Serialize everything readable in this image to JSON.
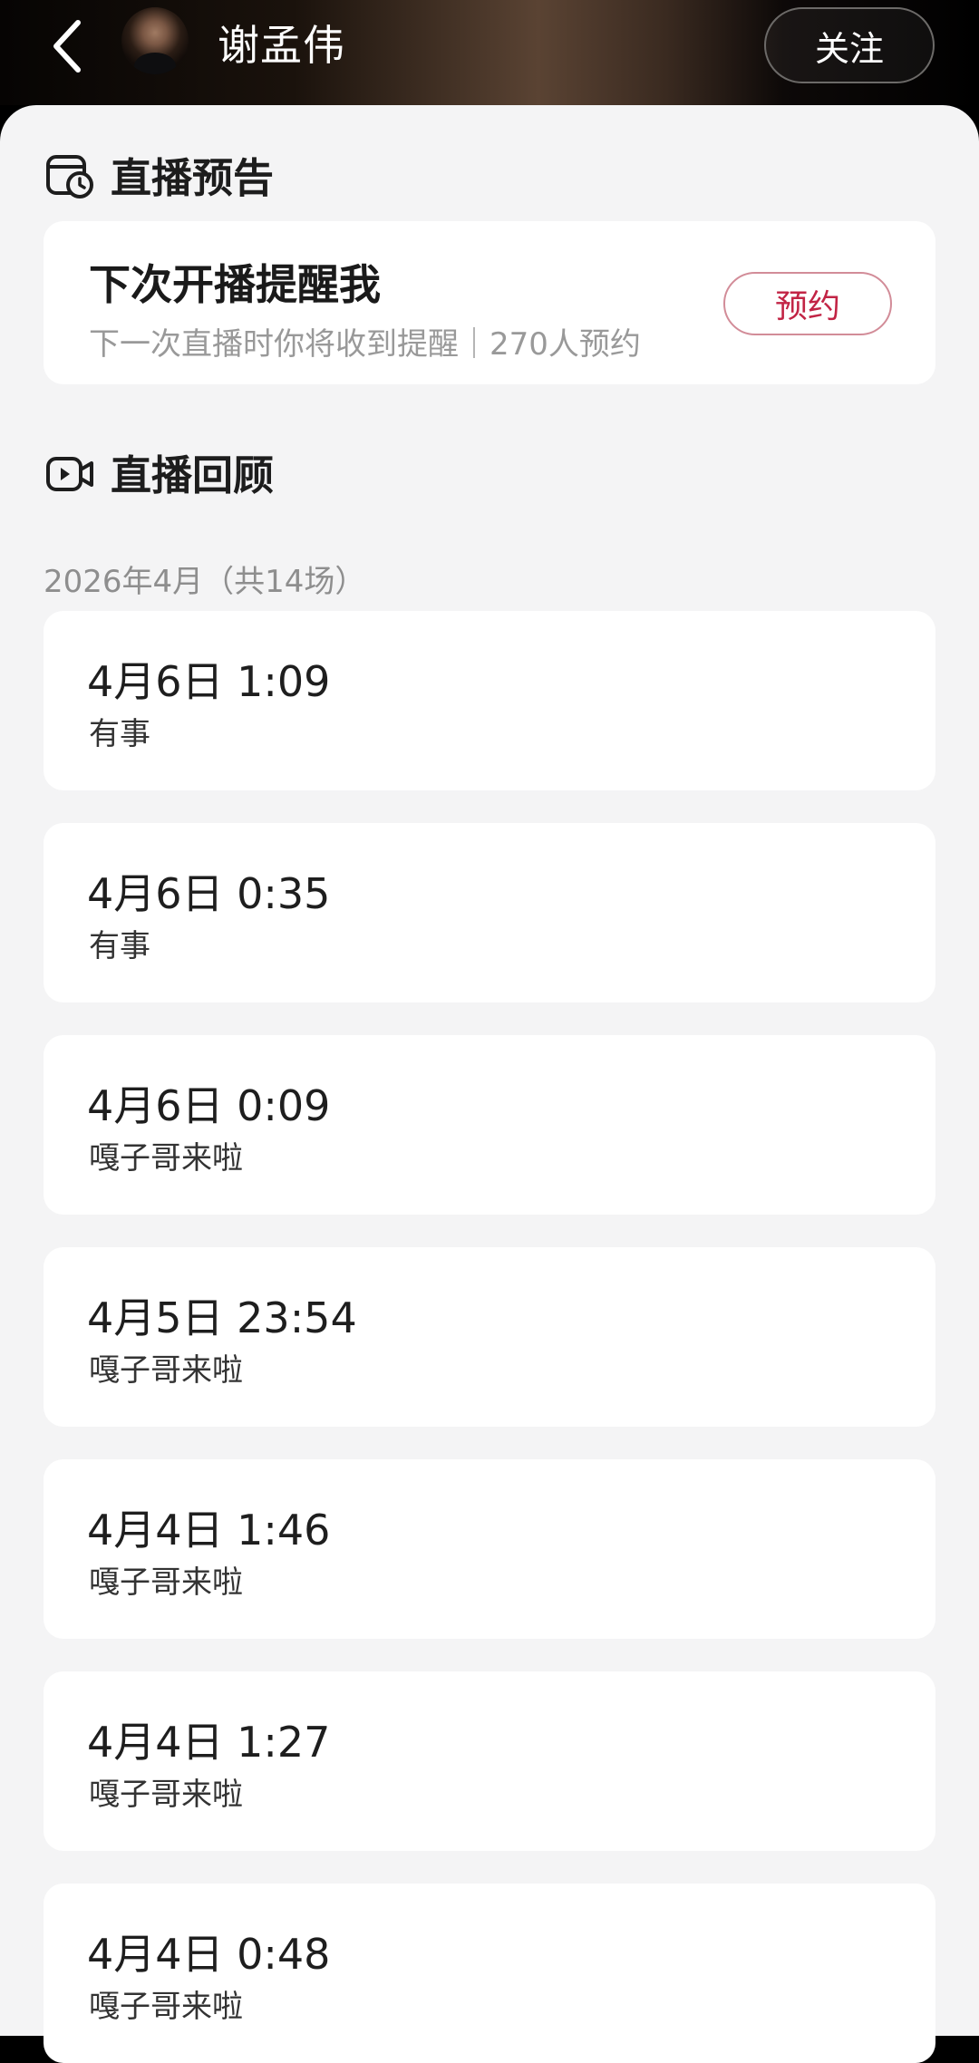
{
  "header": {
    "title": "谢孟伟",
    "follow_label": "关注",
    "back_icon": "chevron-left-icon"
  },
  "preview": {
    "title": "直播预告",
    "icon": "calendar-clock-icon",
    "card": {
      "title": "下次开播提醒我",
      "subtitle": "下一次直播时你将收到提醒｜270人预约",
      "reserve_label": "预约"
    }
  },
  "review": {
    "title": "直播回顾",
    "icon": "video-play-icon",
    "month_label": "2026年4月（共14场）",
    "sessions": [
      {
        "time": "4月6日 1:09",
        "topic": "有事"
      },
      {
        "time": "4月6日 0:35",
        "topic": "有事"
      },
      {
        "time": "4月6日 0:09",
        "topic": "嘎子哥来啦"
      },
      {
        "time": "4月5日 23:54",
        "topic": "嘎子哥来啦"
      },
      {
        "time": "4月4日 1:46",
        "topic": "嘎子哥来啦"
      },
      {
        "time": "4月4日 1:27",
        "topic": "嘎子哥来啦"
      },
      {
        "time": "4月4日 0:48",
        "topic": "嘎子哥来啦"
      }
    ]
  },
  "colors": {
    "accent": "#c22445",
    "background": "#f4f4f5",
    "card": "#ffffff"
  }
}
